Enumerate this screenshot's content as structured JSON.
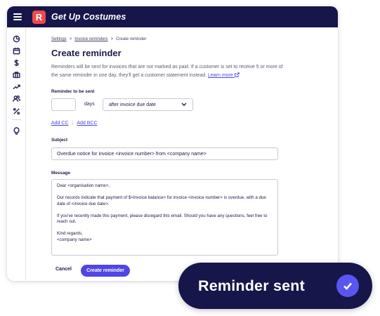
{
  "app": {
    "org_name": "Get Up Costumes",
    "logo_letter": "R",
    "colors": {
      "navy": "#16164a",
      "accent": "#4f46e5",
      "logo_red": "#ef4a4a"
    }
  },
  "sidebar": {
    "icons": [
      "dashboard-icon",
      "calendar-icon",
      "dollar-icon",
      "briefcase-icon",
      "trend-icon",
      "people-icon",
      "percent-icon",
      "lightbulb-icon"
    ]
  },
  "breadcrumb": {
    "settings": "Settings",
    "invoice_reminders": "Invoice reminders",
    "current": "Create reminder",
    "separator": ">"
  },
  "page": {
    "title": "Create reminder",
    "description": "Reminders will be sent for invoices that are not marked as paid. If a customer is set to receive 5 or more of the same reminder in one day, they'll get a customer statement instead.",
    "learn_more": "Learn more"
  },
  "reminder": {
    "label": "Reminder to be sent",
    "days_value": "",
    "days_label": "days",
    "timing_selected": "after invoice due date"
  },
  "cc": {
    "add_cc": "Add CC",
    "add_bcc": "Add BCC"
  },
  "subject": {
    "label": "Subject",
    "value": "Overdue notice for invoice <invoice number> from <company name>"
  },
  "message": {
    "label": "Message",
    "paragraphs": [
      "Dear <organisation name>,",
      "Our records indicate that payment of $<invoice balance> for invoice <invoice number> is overdue, with a due date of <invoice due date>.",
      "If you've recently made this payment, please disregard this email. Should you have any questions, feel free to reach out.",
      "Kind regards,\n<company name>"
    ]
  },
  "actions": {
    "cancel": "Cancel",
    "create": "Create reminder"
  },
  "toast": {
    "text": "Reminder sent"
  }
}
